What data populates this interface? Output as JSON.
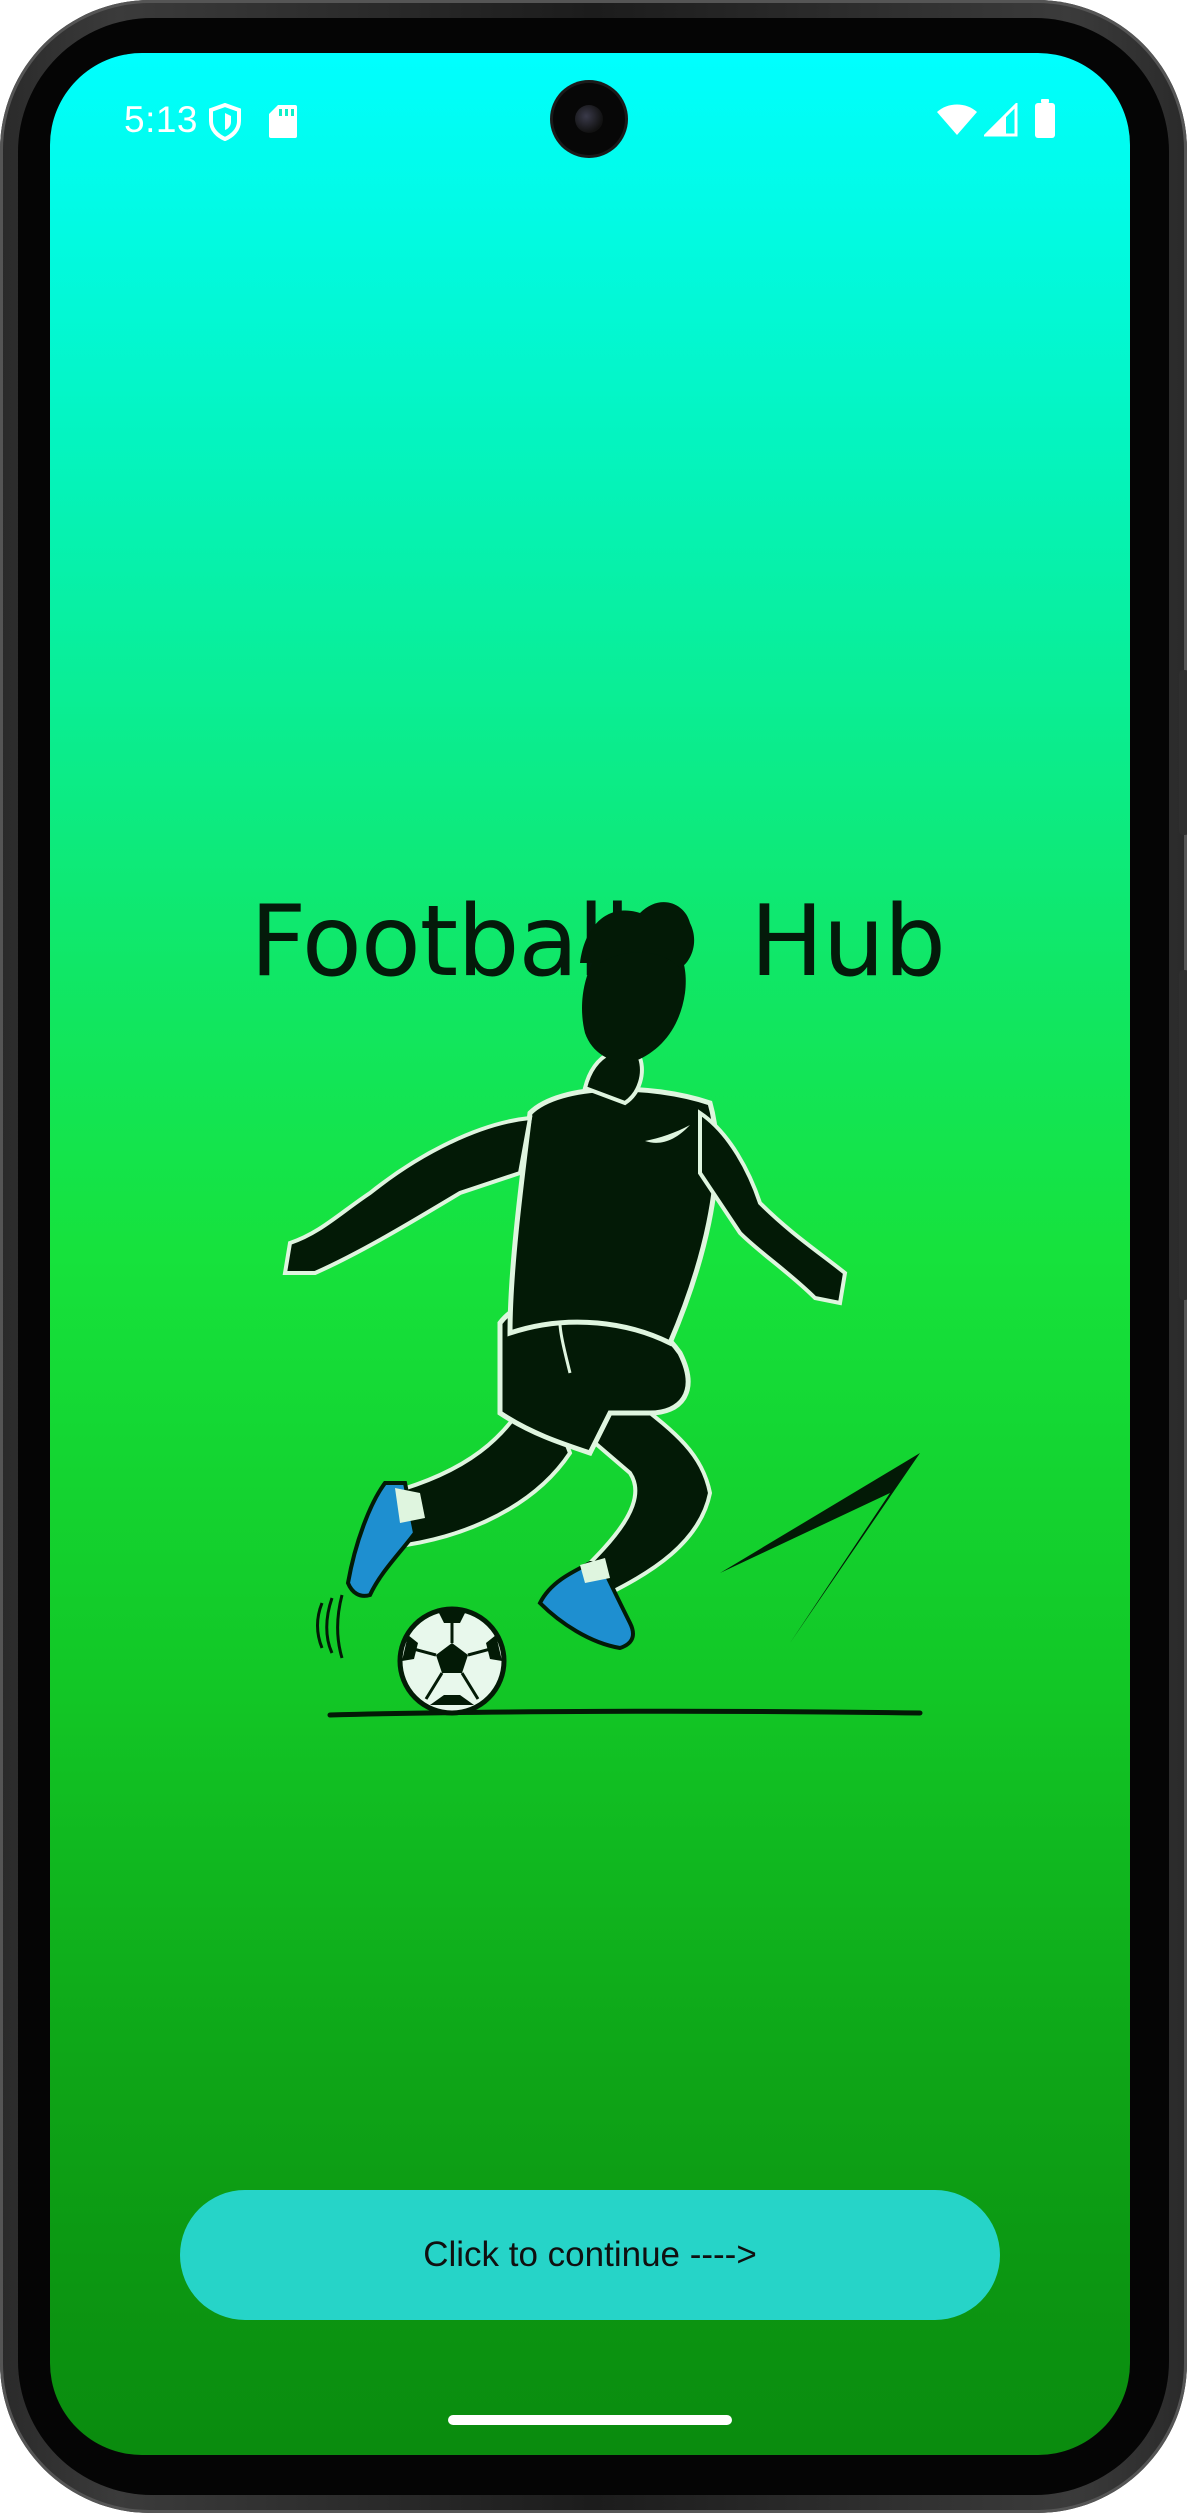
{
  "status_bar": {
    "time": "5:13",
    "left_icons": [
      "shield-icon",
      "sd-card-icon"
    ],
    "right_icons": [
      "wifi-icon",
      "signal-icon",
      "battery-icon"
    ]
  },
  "app": {
    "title_part_1": "Football",
    "title_part_2": "Hub",
    "illustration": "football-player-illustration",
    "continue_button_label": "Click to continue  ---->"
  },
  "colors": {
    "gradient_top": "#00ffff",
    "gradient_bottom": "#0a8b0e",
    "button_bg": "#26d4c8",
    "title_color": "#041a0a",
    "boot_color": "#1e8fd0"
  }
}
